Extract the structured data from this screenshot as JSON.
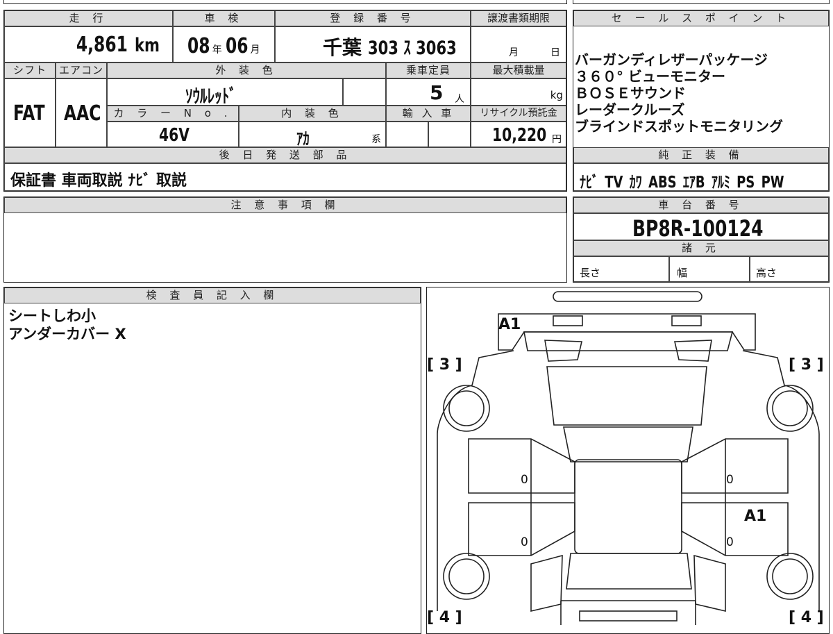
{
  "labels": {
    "mileage": "走 行",
    "inspection": "車 検",
    "registration": "登 録 番 号",
    "transfer_deadline": "譲渡書類期限",
    "sales_point": "セ ー ル ス ポ イ ン ト",
    "shift": "シフト",
    "aircon": "エアコン",
    "exterior_color": "外 装 色",
    "capacity": "乗車定員",
    "max_load": "最大積載量",
    "color_no": "カ ラ ー N o .",
    "interior_color": "内 装 色",
    "import": "輸 入 車",
    "recycle": "リサイクル預託金",
    "later_parts": "後 日 発 送 部 品",
    "genuine_equipment": "純 正 装 備",
    "notes": "注 意 事 項 欄",
    "chassis": "車 台 番 号",
    "specs": "諸 元",
    "length": "長さ",
    "width": "幅",
    "height": "高さ",
    "inspector": "検 査 員 記 入 欄"
  },
  "vehicle": {
    "mileage_value": "4,861",
    "mileage_unit": "km",
    "inspection_year": "08",
    "year_unit": "年",
    "inspection_month": "06",
    "month_unit": "月",
    "reg_area": "千葉",
    "reg_number": "303 ｽ 3063",
    "deadline_month": "月",
    "deadline_day": "日",
    "shift": "FAT",
    "aircon": "AAC",
    "exterior_color": "ｿｳﾙﾚｯﾄﾞ",
    "capacity": "5",
    "capacity_unit": "人",
    "max_load_unit": "kg",
    "color_no": "46V",
    "interior_color": "ｱｶ",
    "interior_suffix": "系",
    "recycle_fee": "10,220",
    "recycle_unit": "円",
    "later_parts": "保証書 車両取説 ﾅﾋﾞ 取説",
    "chassis_no": "BP8R-100124"
  },
  "sales_points": [
    "バーガンディレザーパッケージ",
    "３６０° ビューモニター",
    "ＢＯＳＥサウンド",
    "レーダークルーズ",
    "ブラインドスポットモニタリング"
  ],
  "equipment": "ﾅﾋﾞ  TV  ｶﾜ  ABS  ｴｱB  ｱﾙﾐ  PS  PW",
  "inspector_notes": [
    "シートしわ小",
    "アンダーカバー X"
  ],
  "diagram": {
    "front_left_bracket": "[ 3 ]",
    "front_right_bracket": "[ 3 ]",
    "rear_left_bracket": "[ 4 ]",
    "rear_right_bracket": "[ 4 ]",
    "front_mark": "A1",
    "right_door_mark": "A1",
    "door_mark_1": "0",
    "door_mark_2": "0",
    "door_mark_3": "0",
    "door_mark_4": "0"
  }
}
